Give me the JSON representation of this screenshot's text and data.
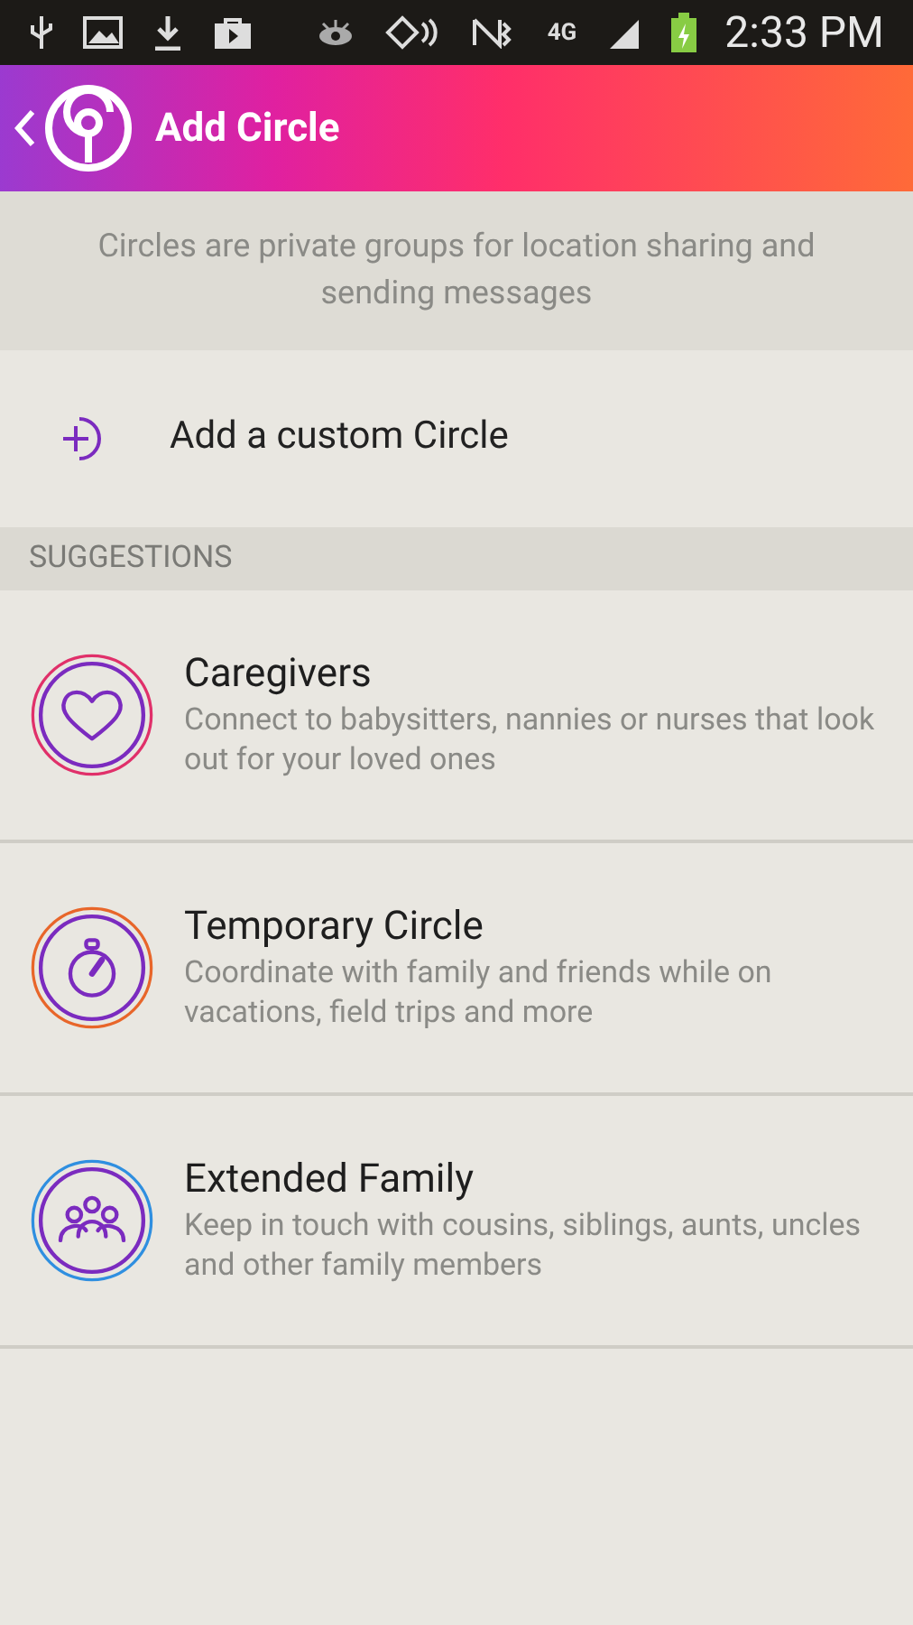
{
  "status_bar": {
    "network_type": "4G",
    "time": "2:33 PM"
  },
  "header": {
    "title": "Add Circle"
  },
  "intro": "Circles are private groups for location sharing and sending messages",
  "custom_action": {
    "label": "Add a custom Circle"
  },
  "section_title": "SUGGESTIONS",
  "suggestions": [
    {
      "kind": "heart",
      "color": "#e0306a",
      "title": "Caregivers",
      "description": "Connect to babysitters, nannies or nurses that look out for your loved ones"
    },
    {
      "kind": "stopwatch",
      "color": "#e8662a",
      "title": "Temporary Circle",
      "description": "Coordinate with family and friends while on vacations, field trips and more"
    },
    {
      "kind": "people",
      "color": "#2f8fe0",
      "title": "Extended Family",
      "description": "Keep in touch with cousins, siblings, aunts, uncles and other family members"
    }
  ]
}
